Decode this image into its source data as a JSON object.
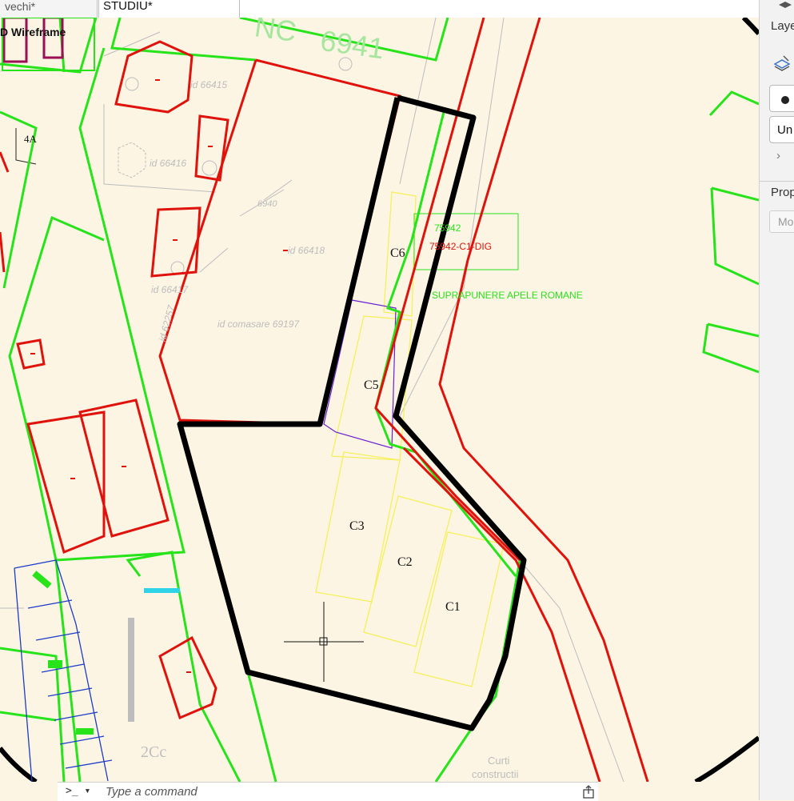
{
  "tabs": {
    "previous": "vechi*",
    "active": "STUDIU*"
  },
  "viewport": {
    "label": "D Wireframe"
  },
  "right_panel": {
    "layers_title": "Layers",
    "layer_value": "Un",
    "properties_title": "Properties",
    "properties_select": "Mo"
  },
  "command_line": {
    "prompt": ">_ ▾",
    "placeholder": "Type a command"
  },
  "drawing": {
    "labels": {
      "nc_top": "NC",
      "nc_number": "6941",
      "plot_code": "75942",
      "plot_code_dig": "75942-C1-DIG",
      "overlay_note": "SUPRAPUNERE APELE ROMANE",
      "merge_id": "id comasare 69197",
      "id_66415": "id 66415",
      "id_66416": "id 66416",
      "id_66417": "id 66417",
      "id_66418": "id 66418",
      "id_62257": "id 62257",
      "nc_6940": "6940",
      "house_number": "4A",
      "building_c1": "C1",
      "building_c2": "C2",
      "building_c3": "C3",
      "building_c5": "C5",
      "building_c6": "C6",
      "zone_code": "2Cc",
      "yards_line1": "Curti",
      "yards_line2": "constructii"
    }
  },
  "colors": {
    "background": "#fcf5e4",
    "boundary": "#000000",
    "cadastre_red": "#e0120c",
    "parcel_green": "#27e31a",
    "building_yellow": "#f5f05a",
    "overlay_purple": "#6a1fd0",
    "annotation_grey": "#bdbdbd"
  }
}
